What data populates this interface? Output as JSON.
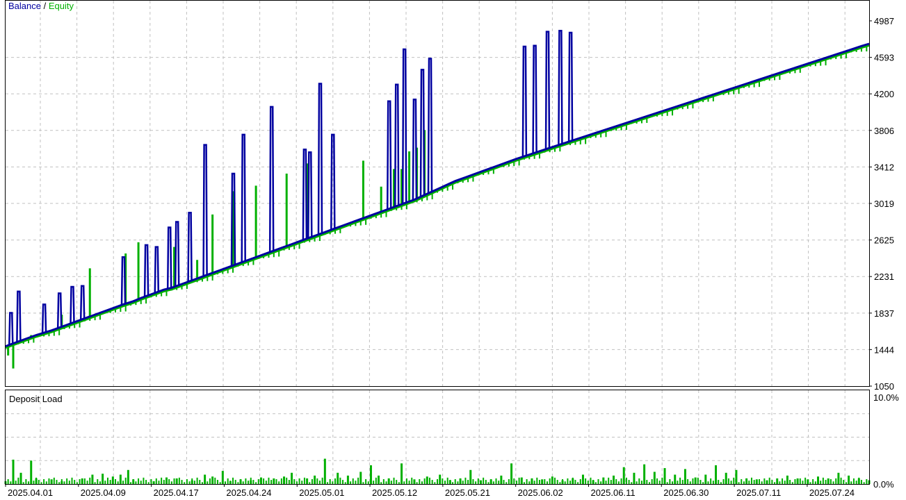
{
  "legend": {
    "balance": "Balance",
    "separator": " / ",
    "equity": "Equity"
  },
  "subchart": {
    "title": "Deposit Load",
    "top_label": "10.0%",
    "bottom_label": "0.0%"
  },
  "colors": {
    "balance": "#0000a0",
    "equity": "#00b000",
    "load": "#00b000",
    "grid": "#c0c0c0",
    "frame": "#000000"
  },
  "chart_data": [
    {
      "type": "line",
      "series": [
        {
          "name": "Balance"
        },
        {
          "name": "Equity"
        }
      ],
      "y_ticks": [
        4987,
        4593,
        4200,
        3806,
        3412,
        3019,
        2625,
        2231,
        1837,
        1444,
        1050
      ],
      "ylim": [
        1050,
        4987
      ],
      "x_ticks": [
        "2025.04.01",
        "2025.04.09",
        "2025.04.17",
        "2025.04.24",
        "2025.05.01",
        "2025.05.12",
        "2025.05.21",
        "2025.06.02",
        "2025.06.11",
        "2025.06.30",
        "2025.07.11",
        "2025.07.24"
      ],
      "balance_points": [
        [
          0,
          1480
        ],
        [
          3,
          1510
        ],
        [
          6,
          1540
        ],
        [
          9,
          1570
        ],
        [
          12,
          1600
        ],
        [
          15,
          1625
        ],
        [
          18,
          1650
        ],
        [
          22,
          1690
        ],
        [
          26,
          1730
        ],
        [
          30,
          1770
        ],
        [
          34,
          1810
        ],
        [
          38,
          1850
        ],
        [
          42,
          1890
        ],
        [
          46,
          1930
        ],
        [
          50,
          1965
        ],
        [
          53,
          2000
        ],
        [
          56,
          2030
        ],
        [
          59,
          2060
        ],
        [
          62,
          2090
        ],
        [
          65,
          2110
        ],
        [
          68,
          2140
        ],
        [
          71,
          2170
        ],
        [
          74,
          2200
        ],
        [
          77,
          2230
        ],
        [
          80,
          2260
        ],
        [
          84,
          2300
        ],
        [
          88,
          2340
        ],
        [
          92,
          2380
        ],
        [
          96,
          2420
        ],
        [
          100,
          2460
        ],
        [
          104,
          2500
        ],
        [
          108,
          2540
        ],
        [
          112,
          2580
        ],
        [
          116,
          2620
        ],
        [
          120,
          2660
        ],
        [
          124,
          2700
        ],
        [
          128,
          2740
        ],
        [
          132,
          2780
        ],
        [
          136,
          2820
        ],
        [
          140,
          2860
        ],
        [
          144,
          2900
        ],
        [
          148,
          2940
        ],
        [
          152,
          2980
        ],
        [
          156,
          3020
        ],
        [
          160,
          3060
        ],
        [
          164,
          3110
        ],
        [
          168,
          3160
        ],
        [
          172,
          3210
        ],
        [
          176,
          3260
        ],
        [
          180,
          3300
        ],
        [
          184,
          3340
        ],
        [
          188,
          3380
        ],
        [
          192,
          3420
        ],
        [
          196,
          3460
        ],
        [
          200,
          3500
        ],
        [
          205,
          3545
        ],
        [
          210,
          3590
        ],
        [
          215,
          3635
        ],
        [
          220,
          3680
        ],
        [
          225,
          3725
        ],
        [
          230,
          3770
        ],
        [
          235,
          3815
        ],
        [
          240,
          3860
        ],
        [
          245,
          3905
        ],
        [
          250,
          3950
        ],
        [
          255,
          3995
        ],
        [
          260,
          4040
        ],
        [
          265,
          4085
        ],
        [
          270,
          4130
        ],
        [
          275,
          4175
        ],
        [
          280,
          4220
        ],
        [
          285,
          4265
        ],
        [
          290,
          4310
        ],
        [
          295,
          4355
        ],
        [
          300,
          4400
        ],
        [
          305,
          4445
        ],
        [
          310,
          4490
        ],
        [
          315,
          4535
        ],
        [
          320,
          4580
        ],
        [
          325,
          4625
        ],
        [
          330,
          4670
        ],
        [
          335,
          4715
        ],
        [
          338,
          4740
        ]
      ],
      "balance_spikes": [
        [
          2,
          1840
        ],
        [
          5,
          2070
        ],
        [
          15,
          1930
        ],
        [
          21,
          2050
        ],
        [
          26,
          2120
        ],
        [
          30,
          2130
        ],
        [
          46,
          2440
        ],
        [
          55,
          2570
        ],
        [
          59,
          2550
        ],
        [
          64,
          2760
        ],
        [
          67,
          2820
        ],
        [
          72,
          2920
        ],
        [
          78,
          3650
        ],
        [
          89,
          3340
        ],
        [
          93,
          3760
        ],
        [
          104,
          4060
        ],
        [
          117,
          3600
        ],
        [
          119,
          3570
        ],
        [
          123,
          4310
        ],
        [
          128,
          3760
        ],
        [
          150,
          4120
        ],
        [
          153,
          4300
        ],
        [
          156,
          4680
        ],
        [
          160,
          4140
        ],
        [
          163,
          4460
        ],
        [
          166,
          4580
        ],
        [
          203,
          4710
        ],
        [
          207,
          4720
        ],
        [
          212,
          4870
        ],
        [
          217,
          4880
        ],
        [
          221,
          4860
        ]
      ],
      "equity_dips": [
        [
          1,
          1380
        ],
        [
          3,
          1240
        ],
        [
          10,
          1600
        ],
        [
          22,
          1820
        ],
        [
          33,
          2320
        ],
        [
          47,
          2480
        ],
        [
          52,
          2600
        ],
        [
          66,
          2550
        ],
        [
          75,
          2410
        ],
        [
          81,
          2900
        ],
        [
          89,
          3150
        ],
        [
          98,
          3210
        ],
        [
          110,
          3340
        ],
        [
          118,
          3450
        ],
        [
          140,
          3480
        ],
        [
          147,
          3200
        ],
        [
          152,
          3390
        ],
        [
          155,
          3390
        ],
        [
          158,
          3580
        ],
        [
          161,
          3620
        ],
        [
          164,
          3810
        ]
      ],
      "deposit_load": [
        [
          0,
          0.3
        ],
        [
          3,
          2.6
        ],
        [
          6,
          1.2
        ],
        [
          10,
          2.5
        ],
        [
          12,
          0.6
        ],
        [
          18,
          0.5
        ],
        [
          22,
          0.3
        ],
        [
          30,
          0.6
        ],
        [
          34,
          1.0
        ],
        [
          38,
          1.1
        ],
        [
          42,
          0.8
        ],
        [
          45,
          1.0
        ],
        [
          48,
          1.5
        ],
        [
          50,
          0.5
        ],
        [
          58,
          0.3
        ],
        [
          63,
          0.7
        ],
        [
          67,
          0.6
        ],
        [
          73,
          0.4
        ],
        [
          78,
          1.0
        ],
        [
          81,
          0.8
        ],
        [
          85,
          1.4
        ],
        [
          88,
          0.3
        ],
        [
          92,
          0.5
        ],
        [
          96,
          0.4
        ],
        [
          100,
          0.7
        ],
        [
          105,
          0.6
        ],
        [
          109,
          0.8
        ],
        [
          112,
          1.2
        ],
        [
          118,
          0.6
        ],
        [
          121,
          0.9
        ],
        [
          125,
          2.7
        ],
        [
          130,
          1.2
        ],
        [
          134,
          0.9
        ],
        [
          139,
          1.3
        ],
        [
          143,
          2.0
        ],
        [
          146,
          0.9
        ],
        [
          150,
          0.6
        ],
        [
          155,
          2.2
        ],
        [
          160,
          0.5
        ],
        [
          165,
          0.8
        ],
        [
          170,
          1.0
        ],
        [
          174,
          0.4
        ],
        [
          178,
          0.6
        ],
        [
          182,
          1.5
        ],
        [
          186,
          0.4
        ],
        [
          190,
          0.5
        ],
        [
          194,
          0.9
        ],
        [
          198,
          2.2
        ],
        [
          202,
          0.7
        ],
        [
          206,
          0.6
        ],
        [
          210,
          0.5
        ],
        [
          214,
          0.8
        ],
        [
          218,
          0.4
        ],
        [
          222,
          0.6
        ],
        [
          226,
          1.0
        ],
        [
          230,
          0.4
        ],
        [
          234,
          0.7
        ],
        [
          238,
          0.9
        ],
        [
          242,
          1.8
        ],
        [
          246,
          1.2
        ],
        [
          250,
          2.1
        ],
        [
          254,
          1.3
        ],
        [
          258,
          1.7
        ],
        [
          262,
          1.0
        ],
        [
          266,
          1.6
        ],
        [
          270,
          0.7
        ],
        [
          274,
          1.0
        ],
        [
          278,
          2.0
        ],
        [
          282,
          1.2
        ],
        [
          286,
          1.5
        ],
        [
          290,
          0.6
        ],
        [
          294,
          0.5
        ],
        [
          298,
          0.4
        ],
        [
          302,
          0.6
        ],
        [
          306,
          0.9
        ],
        [
          310,
          0.6
        ],
        [
          314,
          0.5
        ],
        [
          318,
          0.8
        ],
        [
          322,
          0.6
        ],
        [
          326,
          1.2
        ],
        [
          330,
          0.9
        ],
        [
          334,
          0.6
        ],
        [
          338,
          0.4
        ]
      ],
      "deposit_load_ylim": [
        0,
        10
      ],
      "grid": true
    }
  ]
}
